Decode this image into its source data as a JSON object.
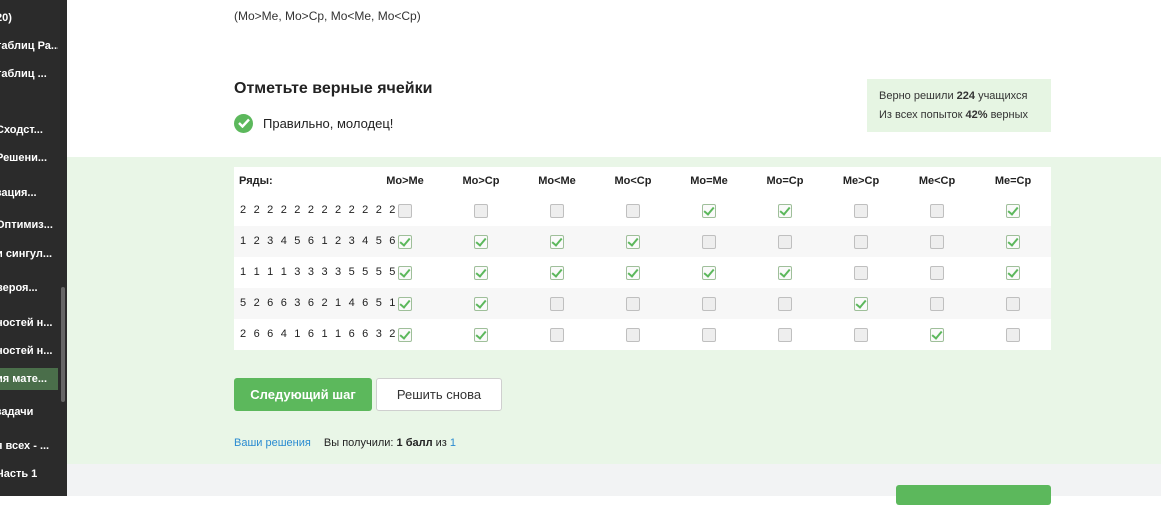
{
  "sidebar": {
    "items": [
      {
        "label": "20)"
      },
      {
        "label": "таблиц Ра..."
      },
      {
        "label": "таблиц ..."
      },
      {
        "label": "Сходст..."
      },
      {
        "label": "Решени..."
      },
      {
        "label": "зация..."
      },
      {
        "label": "Оптимиз..."
      },
      {
        "label": "и сингул..."
      },
      {
        "label": "вероя..."
      },
      {
        "label": "ностей н..."
      },
      {
        "label": "ностей н..."
      },
      {
        "label": "ия мате..."
      },
      {
        "label": "задачи"
      },
      {
        "label": "я всех - ..."
      },
      {
        "label": "Часть 1"
      }
    ]
  },
  "top_text": "(Mo>Me, Mo>Cp, Mo<Me, Mo<Cp)",
  "heading": "Отметьте верные ячейки",
  "correct_message": "Правильно, молодец!",
  "stats": {
    "line1_prefix": "Верно решили ",
    "line1_count": "224",
    "line1_suffix": " учащихся",
    "line2_prefix": "Из всех попыток ",
    "line2_percent": "42%",
    "line2_suffix": " верных"
  },
  "table": {
    "row_header": "Ряды:",
    "columns": [
      "Mo>Me",
      "Mo>Cp",
      "Mo<Me",
      "Mo<Cp",
      "Mo=Me",
      "Mo=Cp",
      "Me>Cp",
      "Me<Cp",
      "Me=Cp"
    ],
    "rows": [
      {
        "label": "2 2 2 2 2 2 2 2 2 2 2 2",
        "checks": [
          false,
          false,
          false,
          false,
          true,
          true,
          false,
          false,
          true
        ]
      },
      {
        "label": "1 2 3 4 5 6 1 2 3 4 5 6",
        "checks": [
          true,
          true,
          true,
          true,
          false,
          false,
          false,
          false,
          true
        ]
      },
      {
        "label": "1 1 1 1 3 3 3 3 5 5 5 5",
        "checks": [
          true,
          true,
          true,
          true,
          true,
          true,
          false,
          false,
          true
        ]
      },
      {
        "label": "5 2 6 6 3 6 2 1 4 6 5 1",
        "checks": [
          true,
          true,
          false,
          false,
          false,
          false,
          true,
          false,
          false
        ]
      },
      {
        "label": "2 6 6 4 1 6 1 1 6 6 3 2",
        "checks": [
          true,
          true,
          false,
          false,
          false,
          false,
          false,
          true,
          false
        ]
      }
    ]
  },
  "buttons": {
    "next": "Следующий шаг",
    "again": "Решить снова"
  },
  "footer": {
    "link": "Ваши решения",
    "got_prefix": "Вы получили: ",
    "got_value": "1 балл",
    "got_mid": " из ",
    "got_total": "1"
  },
  "colors": {
    "accent_green": "#5cb85c",
    "band_bg": "#e9f6e7",
    "sidebar_bg": "#2b2b2b",
    "link_blue": "#2a8bd1"
  }
}
